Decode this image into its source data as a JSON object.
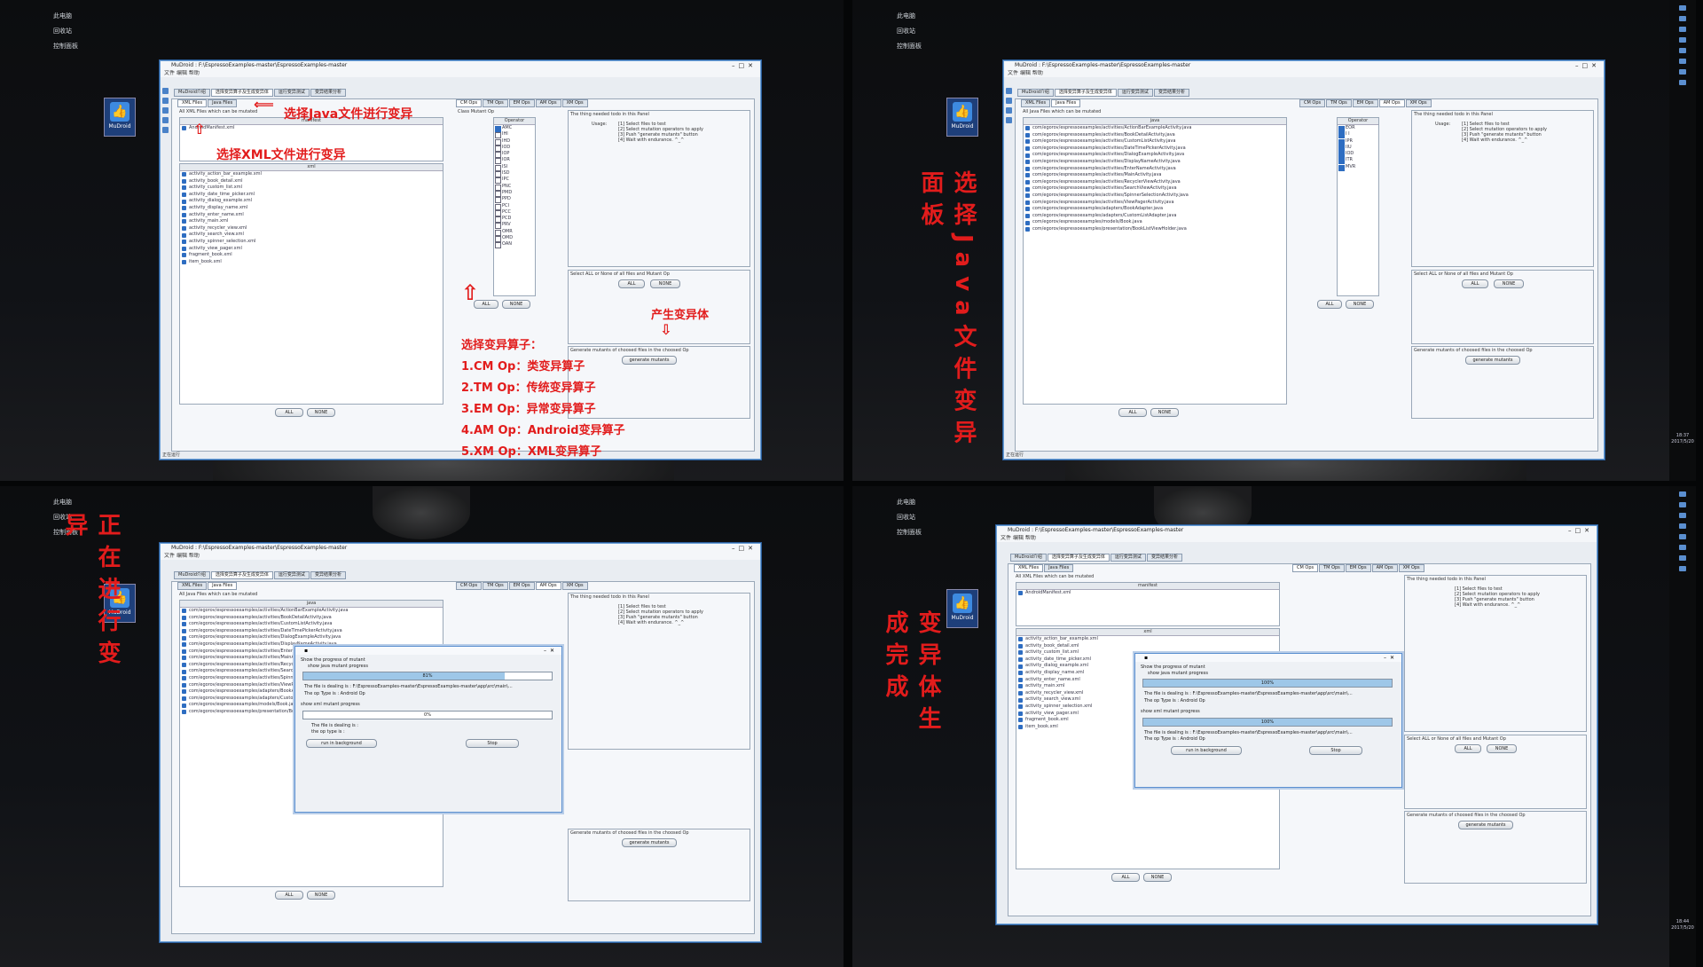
{
  "desktop": {
    "items": [
      "此电脑",
      "回收站",
      "控制面板"
    ],
    "icon_label": "MuDroid"
  },
  "window": {
    "title": "MuDroid : F:\\EspressoExamples-master\\EspressoExamples-master",
    "menu": [
      "文件",
      "编辑",
      "帮助"
    ],
    "main_tabs": [
      "MuDroid介绍",
      "选择变异算子及生成变异体",
      "运行变异测试",
      "变异结果分析"
    ],
    "file_tabs": [
      "XML Files",
      "Java Files"
    ],
    "op_tabs": [
      "CM Ops",
      "TM Ops",
      "EM Ops",
      "AM Ops",
      "XM Ops"
    ],
    "xml_list_title": "All XML Files which can be mutated",
    "java_list_title": "All Java Files which can be mutated",
    "xml_header_manifest": "manifest",
    "manifest_item": "AndroidManifest.xml",
    "xml_header": "xml",
    "xml_files": [
      "activity_action_bar_example.xml",
      "activity_book_detail.xml",
      "activity_custom_list.xml",
      "activity_date_time_picker.xml",
      "activity_dialog_example.xml",
      "activity_display_name.xml",
      "activity_enter_name.xml",
      "activity_main.xml",
      "activity_recycler_view.xml",
      "activity_search_view.xml",
      "activity_spinner_selection.xml",
      "activity_view_pager.xml",
      "fragment_book.xml",
      "item_book.xml"
    ],
    "java_header": "java",
    "java_files": [
      "com/egorov/espressoexamples/activities/ActionBarExampleActivity.java",
      "com/egorov/espressoexamples/activities/BookDetailActivity.java",
      "com/egorov/espressoexamples/activities/CustomListActivity.java",
      "com/egorov/espressoexamples/activities/DateTimePickerActivity.java",
      "com/egorov/espressoexamples/activities/DialogExampleActivity.java",
      "com/egorov/espressoexamples/activities/DisplayNameActivity.java",
      "com/egorov/espressoexamples/activities/EnterNameActivity.java",
      "com/egorov/espressoexamples/activities/MainActivity.java",
      "com/egorov/espressoexamples/activities/RecyclerViewActivity.java",
      "com/egorov/espressoexamples/activities/SearchViewActivity.java",
      "com/egorov/espressoexamples/activities/SpinnerSelectionActivity.java",
      "com/egorov/espressoexamples/activities/ViewPagerActivity.java",
      "com/egorov/espressoexamples/adapters/BookAdapter.java",
      "com/egorov/espressoexamples/adapters/CustomListAdapter.java",
      "com/egorov/espressoexamples/models/Book.java",
      "com/egorov/espressoexamples/presentation/BookListViewHolder.java"
    ],
    "class_mutant_title": "Class Mutant Op",
    "operator_header": "Operator",
    "class_ops": [
      "AMC",
      "IHI",
      "IHD",
      "IOD",
      "IOP",
      "IOR",
      "ISI",
      "ISD",
      "IPC",
      "PNC",
      "PMD",
      "PPD",
      "PCI",
      "PCC",
      "PCD",
      "PRV",
      "OMR",
      "OMD",
      "OAN"
    ],
    "java_ops": [
      "EOR",
      "I I",
      "IPR",
      "IIU",
      "IOD",
      "ITR",
      "MVR"
    ],
    "todo_title": "The thing needed todo in this Panel",
    "todo_usage": "Usage:",
    "todo_steps": [
      "[1] Select files to test",
      "[2] Select mutation operators to apply",
      "[3] Push \"generate mutants\" button",
      "[4] Wait with endurance. ^_^"
    ],
    "select_title": "Select ALL or None of all files and Mutant Op",
    "generate_title": "Generate mutants of choosed files in the choosed Op",
    "btn_all": "ALL",
    "btn_none": "NONE",
    "btn_generate": "generate mutants",
    "status": "正在运行"
  },
  "dialog": {
    "title": "Show the progress of mutant",
    "java_progress_label": "show java mutant progress",
    "file_dealing": "The file is dealing is : F:\\EspressoExamples-master\\EspressoExamples-master\\app\\src\\main\\...",
    "op_type": "The op Type is : Android Op",
    "xml_progress_label": "show xml mutant progress",
    "xml_file_dealing": "The file is dealing is :",
    "xml_op_type": "the op type is :",
    "btn_background": "run in background",
    "btn_stop": "Stop",
    "p1": 81,
    "p2": 0,
    "p3": 100,
    "p4": 100
  },
  "annotations": {
    "choose_java": "选择Java文件进行变异",
    "choose_xml": "选择XML文件进行变异",
    "ops_title": "选择变异算子：",
    "ops": [
      "1.CM Op：类变异算子",
      "2.TM Op：传统变异算子",
      "3.EM Op：异常变异算子",
      "4.AM Op：Android变异算子",
      "5.XM Op：XML变异算子"
    ],
    "produce": "产生变异体",
    "java_panel": "选择Java文件变异面板",
    "mutating": "正在进行变异",
    "done": "变异体生成完成"
  },
  "clock": {
    "time": "18:37",
    "date": "2017/5/20",
    "time2": "18:44"
  },
  "colors": {
    "accent": "#e21c1c",
    "window_border": "#6a9fd6"
  }
}
